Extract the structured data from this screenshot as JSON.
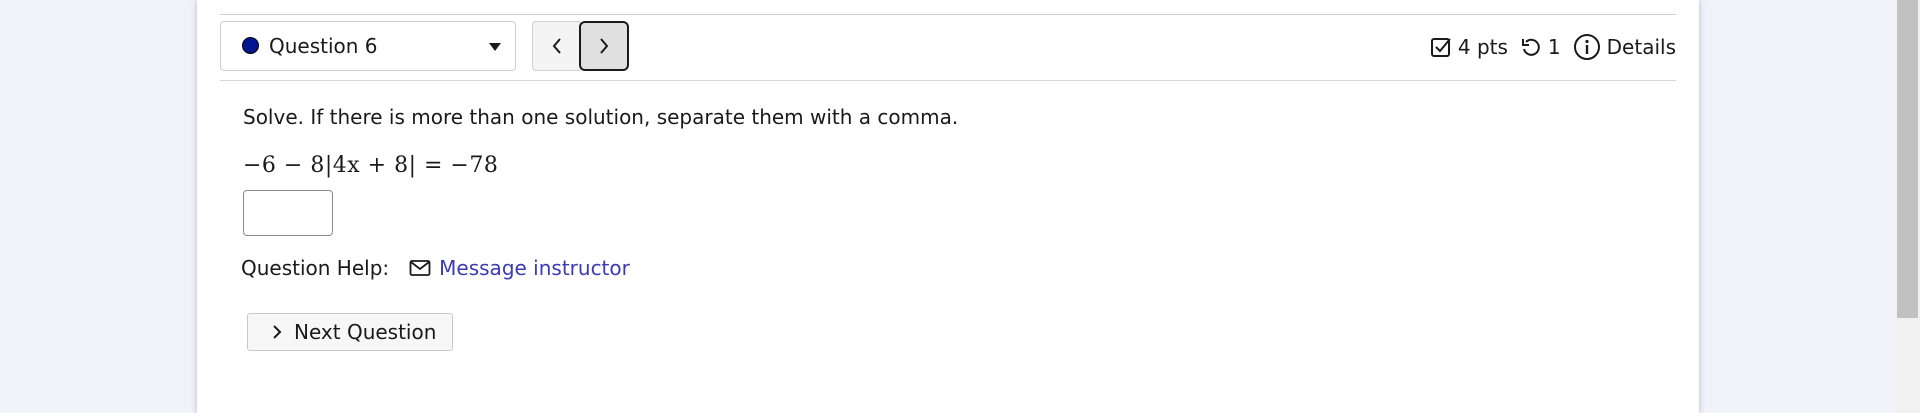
{
  "header": {
    "question_select": {
      "label": "Question 6",
      "status_color": "#00158f"
    },
    "prev_button": {
      "icon": "chevron-left-icon"
    },
    "next_button": {
      "icon": "chevron-right-icon"
    },
    "points": "4 pts",
    "attempts": "1",
    "details": "Details"
  },
  "question": {
    "prompt": "Solve. If there is more than one solution, separate them with a comma.",
    "equation": "−6 − 8|4x + 8| = −78",
    "answer_value": ""
  },
  "help": {
    "label": "Question Help:",
    "message_link": "Message instructor",
    "link_color": "#3b3bb3"
  },
  "next_question": {
    "label": "Next Question"
  }
}
